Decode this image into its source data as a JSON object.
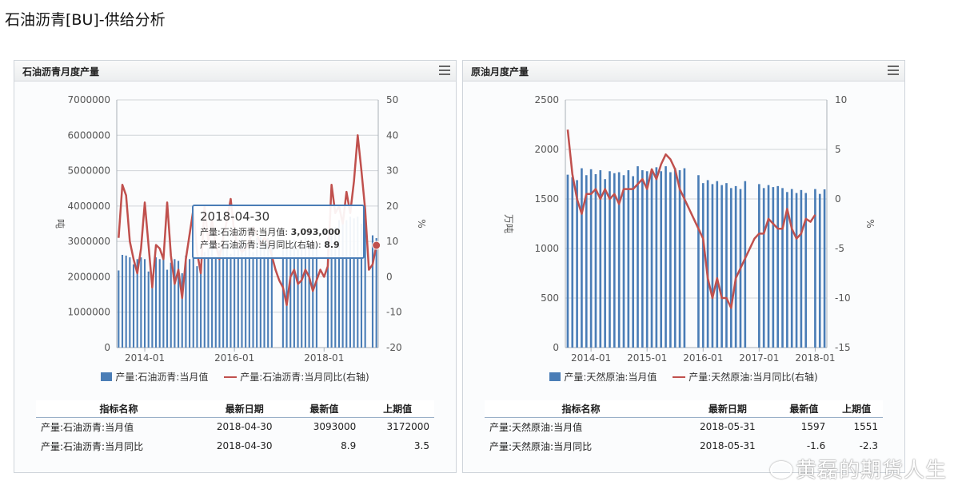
{
  "page": {
    "title": "石油沥青[BU]-供给分析"
  },
  "panels": [
    {
      "title": "石油沥青月度产量",
      "legend": {
        "bar": "产量:石油沥青:当月值",
        "line": "产量:石油沥青:当月同比(右轴)"
      },
      "tooltip": {
        "date": "2018-04-30",
        "line1_label": "产量:石油沥青:当月值: ",
        "line1_value": "3,093,000",
        "line2_label": "产量:石油沥青:当月同比(右轴): ",
        "line2_value": "8.9"
      },
      "table": {
        "headers": [
          "指标名称",
          "最新日期",
          "最新值",
          "上期值"
        ],
        "rows": [
          [
            "产量:石油沥青:当月值",
            "2018-04-30",
            "3093000",
            "3172000"
          ],
          [
            "产量:石油沥青:当月同比",
            "2018-04-30",
            "8.9",
            "3.5"
          ]
        ]
      }
    },
    {
      "title": "原油月度产量",
      "legend": {
        "bar": "产量:天然原油:当月值",
        "line": "产量:天然原油:当月同比(右轴)"
      },
      "table": {
        "headers": [
          "指标名称",
          "最新日期",
          "最新值",
          "上期值"
        ],
        "rows": [
          [
            "产量:天然原油:当月值",
            "2018-05-31",
            "1597",
            "1551"
          ],
          [
            "产量:天然原油:当月同比",
            "2018-05-31",
            "-1.6",
            "-2.3"
          ]
        ]
      }
    }
  ],
  "watermark": "黄磊的期货人生",
  "colors": {
    "bar": "#4a7db6",
    "line": "#c0504d",
    "grid": "#d0d4d8"
  },
  "chart_data": [
    {
      "type": "bar",
      "title": "石油沥青月度产量",
      "ylabel": "吨",
      "y2label": "%",
      "ylim": [
        0,
        7000000
      ],
      "y2lim": [
        -20,
        50
      ],
      "yticks": [
        "0",
        "1000000",
        "2000000",
        "3000000",
        "4000000",
        "5000000",
        "6000000",
        "7000000"
      ],
      "y2ticks": [
        "-20",
        "-10",
        "0",
        "10",
        "20",
        "30",
        "40",
        "50"
      ],
      "xticks": [
        "2014-01",
        "2016-01",
        "2018-01"
      ],
      "x_start": "2013-06",
      "series": [
        {
          "name": "产量:石油沥青:当月值",
          "kind": "bar",
          "values": [
            2180000,
            2620000,
            2600000,
            2550000,
            2350000,
            2500000,
            2550000,
            2500000,
            2150000,
            2000000,
            2550000,
            2500000,
            2600000,
            2200000,
            2400000,
            2500000,
            2450000,
            2100000,
            2600000,
            2500000,
            2650000,
            2300000,
            2200000,
            2700000,
            2800000,
            2900000,
            2550000,
            2750000,
            2900000,
            3000000,
            2650000,
            2800000,
            3050000,
            3100000,
            2950000,
            2800000,
            2700000,
            3100000,
            3200000,
            3000000,
            3100000,
            2900000,
            null,
            null,
            2750000,
            2800000,
            2950000,
            3050000,
            2800000,
            2900000,
            3100000,
            2900000,
            2800000,
            2950000,
            null,
            null,
            3100000,
            3300000,
            3400000,
            3600000,
            3500000,
            3600000,
            3700000,
            3650000,
            3700000,
            3500000,
            3650000,
            null,
            3172000,
            3093000
          ]
        },
        {
          "name": "产量:石油沥青:当月同比(右轴)",
          "kind": "line",
          "values": [
            11,
            26,
            23,
            10,
            5,
            1,
            8,
            21,
            9,
            -3,
            9,
            8,
            5,
            21,
            6,
            -2,
            2,
            -6,
            5,
            12,
            19,
            7,
            1,
            20,
            10,
            16,
            9,
            5,
            11,
            16,
            22,
            12,
            9,
            7,
            8,
            10,
            14,
            12,
            9,
            11,
            10,
            6,
            2,
            -1,
            -3,
            -8,
            0,
            2,
            -2,
            -1,
            2,
            0,
            -4,
            -1,
            2,
            0,
            3,
            26,
            18,
            20,
            15,
            24,
            18,
            27,
            40,
            30,
            19,
            2,
            3.5,
            8.9
          ]
        }
      ]
    },
    {
      "type": "bar",
      "title": "原油月度产量",
      "ylabel": "万吨",
      "y2label": "%",
      "ylim": [
        0,
        2500
      ],
      "y2lim": [
        -15,
        10
      ],
      "yticks": [
        "0",
        "500",
        "1000",
        "1500",
        "2000",
        "2500"
      ],
      "y2ticks": [
        "-15",
        "-10",
        "-5",
        "0",
        "5",
        "10"
      ],
      "xticks": [
        "2014-01",
        "2015-01",
        "2016-01",
        "2017-01",
        "2018-01"
      ],
      "x_start": "2013-08",
      "series": [
        {
          "name": "产量:天然原油:当月值",
          "kind": "bar",
          "values": [
            1745,
            1720,
            1690,
            1810,
            1740,
            1800,
            1750,
            1790,
            1700,
            1780,
            1760,
            1770,
            1740,
            1790,
            1730,
            1830,
            1790,
            1780,
            1800,
            1820,
            1780,
            1830,
            1770,
            1810,
            1790,
            1810,
            null,
            null,
            1740,
            1660,
            1690,
            1650,
            1680,
            1640,
            1660,
            1610,
            1630,
            1600,
            1680,
            null,
            null,
            1650,
            1610,
            1640,
            1620,
            1630,
            1610,
            1570,
            1600,
            1560,
            1590,
            1560,
            null,
            1600,
            1551,
            1597
          ]
        },
        {
          "name": "产量:天然原油:当月同比(右轴)",
          "kind": "line",
          "values": [
            7,
            2.5,
            0,
            -1.5,
            0.5,
            0.5,
            1,
            0,
            1,
            0,
            0.5,
            -0.5,
            1,
            1,
            1,
            1.5,
            2,
            1,
            3,
            2,
            3.5,
            4.5,
            4,
            3,
            1,
            0,
            -1,
            -2,
            -3,
            -4,
            -8,
            -10,
            -8,
            -10,
            -10,
            -11,
            -8,
            -7,
            -6,
            -5,
            -4,
            -3.5,
            -3.5,
            -2,
            -2.5,
            -3,
            -3,
            -1,
            -3,
            -4,
            -3.5,
            -2,
            -2.3,
            -1.6
          ]
        }
      ]
    }
  ]
}
